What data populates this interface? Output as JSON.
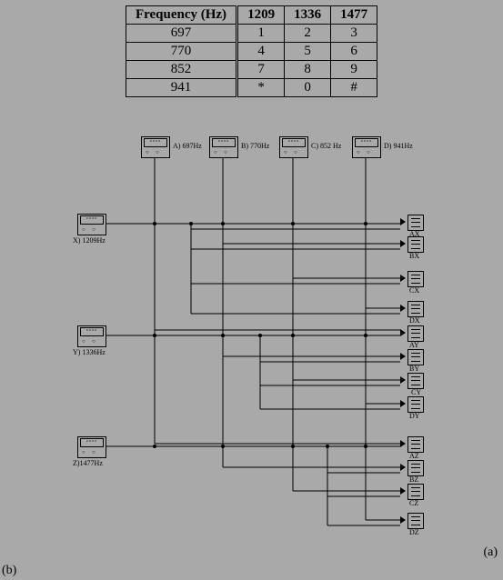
{
  "table": {
    "header": [
      "Frequency (Hz)",
      "1209",
      "1336",
      "1477"
    ],
    "rows": [
      [
        "697",
        "1",
        "2",
        "3"
      ],
      [
        "770",
        "4",
        "5",
        "6"
      ],
      [
        "852",
        "7",
        "8",
        "9"
      ],
      [
        "941",
        "*",
        "0",
        "#"
      ]
    ]
  },
  "topBlocks": [
    {
      "id": "A",
      "label": "A) 697Hz"
    },
    {
      "id": "B",
      "label": "B) 770Hz"
    },
    {
      "id": "C",
      "label": "C) 852 Hz"
    },
    {
      "id": "D",
      "label": "D) 941Hz"
    }
  ],
  "leftBlocks": [
    {
      "id": "X",
      "label": "X) 1209Hz"
    },
    {
      "id": "Y",
      "label": "Y) 1336Hz"
    },
    {
      "id": "Z",
      "label": "Z)1477Hz"
    }
  ],
  "mixers": [
    "AX",
    "BX",
    "CX",
    "DX",
    "AY",
    "BY",
    "CY",
    "DY",
    "AZ",
    "BZ",
    "CZ",
    "DZ"
  ],
  "captions": {
    "a": "(a)",
    "b": "(b)"
  },
  "chart_data": {
    "type": "table",
    "title": "DTMF Frequency Combinations",
    "row_freqs_hz": [
      697,
      770,
      852,
      941
    ],
    "col_freqs_hz": [
      1209,
      1336,
      1477
    ],
    "keys": [
      [
        "1",
        "2",
        "3"
      ],
      [
        "4",
        "5",
        "6"
      ],
      [
        "7",
        "8",
        "9"
      ],
      [
        "*",
        "0",
        "#"
      ]
    ]
  }
}
